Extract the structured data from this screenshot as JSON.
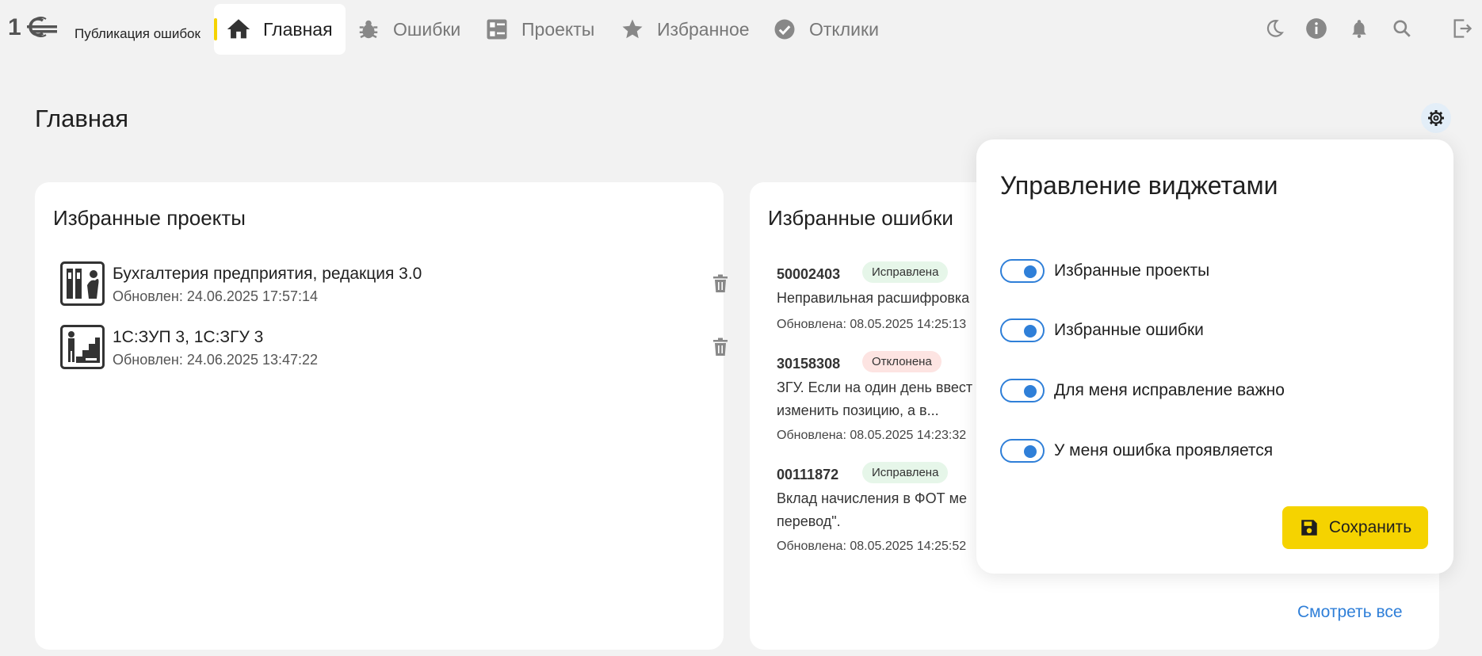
{
  "header": {
    "app_title": "Публикация ошибок",
    "nav": [
      {
        "label": "Главная",
        "icon": "home-icon",
        "active": true
      },
      {
        "label": "Ошибки",
        "icon": "bug-icon"
      },
      {
        "label": "Проекты",
        "icon": "projects-icon"
      },
      {
        "label": "Избранное",
        "icon": "star-icon"
      },
      {
        "label": "Отклики",
        "icon": "check-circle-icon"
      }
    ],
    "right_icons": [
      "moon-icon",
      "info-icon",
      "bell-icon",
      "search-icon",
      "logout-icon"
    ]
  },
  "page": {
    "title": "Главная"
  },
  "favorite_projects": {
    "title": "Избранные проекты",
    "items": [
      {
        "name": "Бухгалтерия предприятия, редакция 3.0",
        "updated": "Обновлен: 24.06.2025 17:57:14"
      },
      {
        "name": "1С:ЗУП 3, 1С:ЗГУ 3",
        "updated": "Обновлен: 24.06.2025 13:47:22"
      }
    ]
  },
  "favorite_errors": {
    "title": "Избранные ошибки",
    "items": [
      {
        "number": "50002403",
        "status": "Исправлена",
        "desc_lines": [
          "Неправильная расшифровка"
        ],
        "updated": "Обновлена: 08.05.2025 14:25:13"
      },
      {
        "number": "30158308",
        "status": "Отклонена",
        "desc_lines": [
          "ЗГУ. Если на один день ввест",
          "изменить позицию, а в..."
        ],
        "updated": "Обновлена: 08.05.2025 14:23:32"
      },
      {
        "number": "00111872",
        "status": "Исправлена",
        "desc_lines": [
          "Вклад начисления в ФОТ ме",
          "перевод\"."
        ],
        "updated": "Обновлена: 08.05.2025 14:25:52"
      }
    ],
    "see_all": "Смотреть все"
  },
  "widgets_popup": {
    "title": "Управление виджетами",
    "toggles": [
      {
        "label": "Избранные проекты",
        "on": true
      },
      {
        "label": "Избранные ошибки",
        "on": true
      },
      {
        "label": "Для меня исправление важно",
        "on": true
      },
      {
        "label": "У меня ошибка проявляется",
        "on": true
      }
    ],
    "save_label": "Сохранить"
  },
  "colors": {
    "accent_yellow": "#f5d300",
    "accent_blue": "#2f7fd8",
    "ok_badge": "#e6f6e9",
    "rejected_badge": "#fde4e2"
  }
}
